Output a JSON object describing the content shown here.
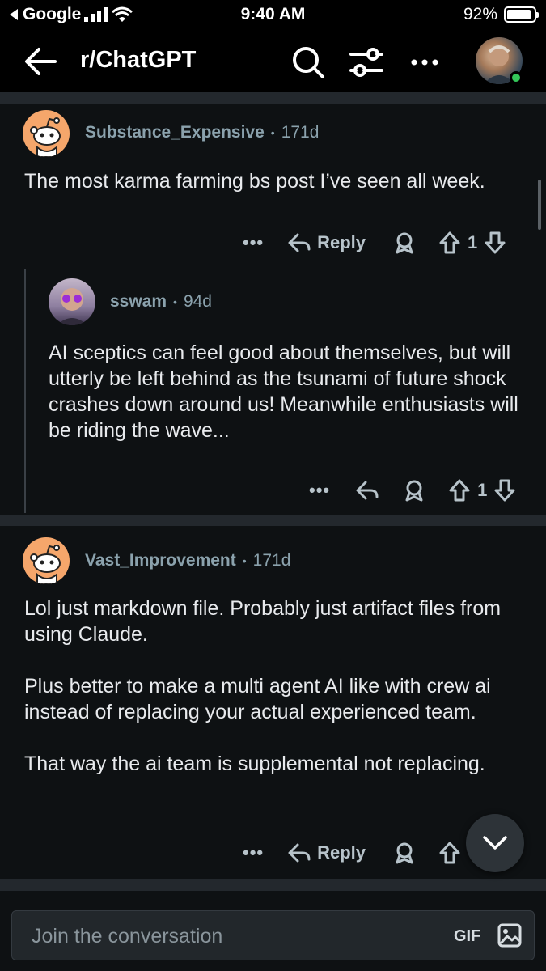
{
  "status": {
    "carrier": "Google",
    "time": "9:40 AM",
    "battery": "92%",
    "battery_level": 0.92
  },
  "header": {
    "title": "r/ChatGPT",
    "icons": [
      "back-arrow-icon",
      "search-icon",
      "filter-icon",
      "more-icon",
      "avatar"
    ]
  },
  "comments": [
    {
      "user": "Substance_Expensive",
      "age": "171d",
      "text": "The most karma farming bs post I’ve seen all week.",
      "reply_label": "Reply",
      "votes": "1"
    },
    {
      "user": "sswam",
      "age": "94d",
      "text": "AI sceptics can feel good about themselves, but will utterly be left behind as the tsunami of future shock crashes down around us! Meanwhile enthusiasts will be riding the wave...",
      "votes": "1"
    },
    {
      "user": "Vast_Improvement",
      "age": "171d",
      "text": "Lol just markdown file. Probably just artifact files from using Claude.\n\nPlus better to make a multi agent AI like with crew ai instead of replacing your actual experienced team.\n\nThat way the ai team is supplemental not replacing.",
      "reply_label": "Reply"
    }
  ],
  "composer": {
    "placeholder": "Join the conversation",
    "gif_label": "GIF"
  },
  "colors": {
    "background": "#0e1113",
    "meta": "#8ba2ad",
    "avatar_orange": "#f5a66b",
    "online": "#34c759"
  }
}
